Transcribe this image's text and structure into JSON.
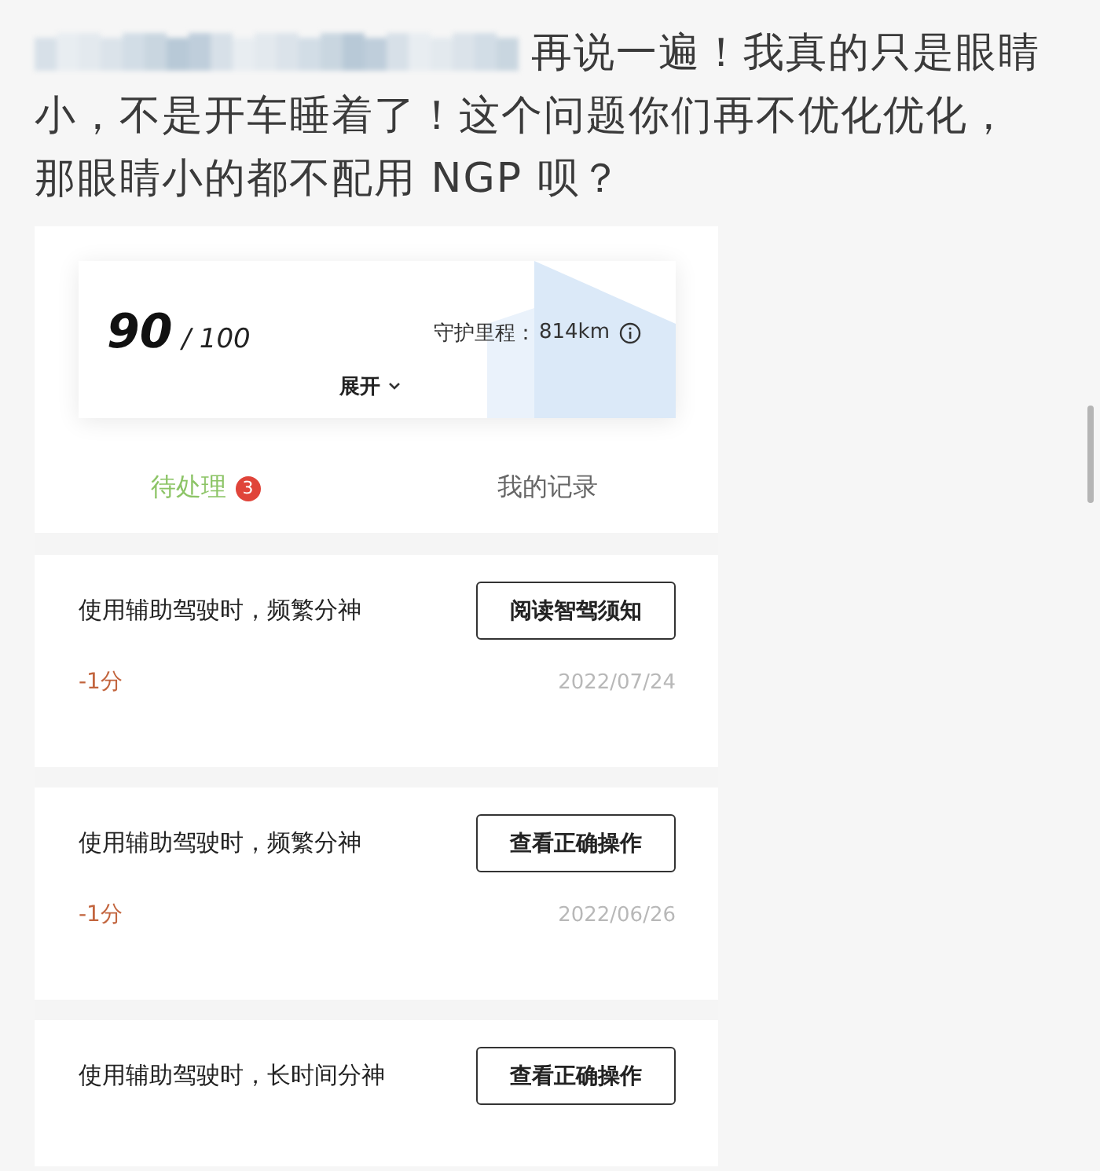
{
  "post": {
    "text": "再说一遍！我真的只是眼睛小，不是开车睡着了！这个问题你们再不优化优化，那眼睛小的都不配用 NGP 呗？"
  },
  "score": {
    "value": "90",
    "max": "/ 100",
    "mileage_label": "守护里程：",
    "mileage": "814km",
    "expand": "展开"
  },
  "tabs": [
    {
      "label": "待处理",
      "selected": true,
      "badge": "3"
    },
    {
      "label": "我的记录",
      "selected": false
    }
  ],
  "records": [
    {
      "title": "使用辅助驾驶时，频繁分神",
      "action": "阅读智驾须知",
      "points": "-1分",
      "date": "2022/07/24"
    },
    {
      "title": "使用辅助驾驶时，频繁分神",
      "action": "查看正确操作",
      "points": "-1分",
      "date": "2022/06/26"
    },
    {
      "title": "使用辅助驾驶时，长时间分神",
      "action": "查看正确操作"
    }
  ]
}
